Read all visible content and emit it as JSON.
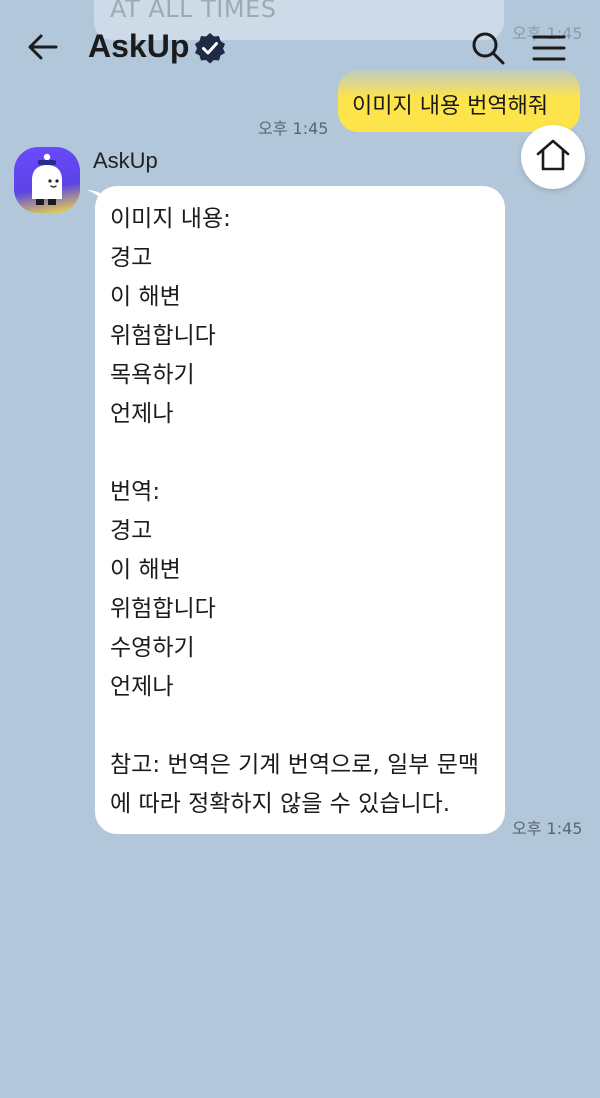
{
  "header": {
    "title": "AskUp",
    "back_icon": "arrow-left-icon",
    "verified_icon": "verified-badge-icon",
    "search_icon": "search-icon",
    "menu_icon": "hamburger-menu-icon"
  },
  "messages": {
    "previous": {
      "text": "AT ALL TIMES",
      "time": "오후 1:45"
    },
    "user": {
      "text": "이미지 내용 번역해줘",
      "time": "오후 1:45"
    },
    "bot": {
      "name": "AskUp",
      "text": "이미지 내용:\n경고\n이 해변\n위험합니다\n목욕하기\n언제나\n\n번역:\n경고\n이 해변\n위험합니다\n수영하기\n언제나\n\n참고: 번역은 기계 번역으로, 일부 문맥에 따라 정확하지 않을 수 있습니다.",
      "time": "오후 1:45"
    }
  },
  "floating": {
    "home_icon": "home-icon"
  },
  "colors": {
    "background": "#b2c7da",
    "user_bubble": "#fee44b",
    "bot_bubble": "#ffffff",
    "avatar_purple": "#6c4bff",
    "verified": "#1f2a44"
  }
}
